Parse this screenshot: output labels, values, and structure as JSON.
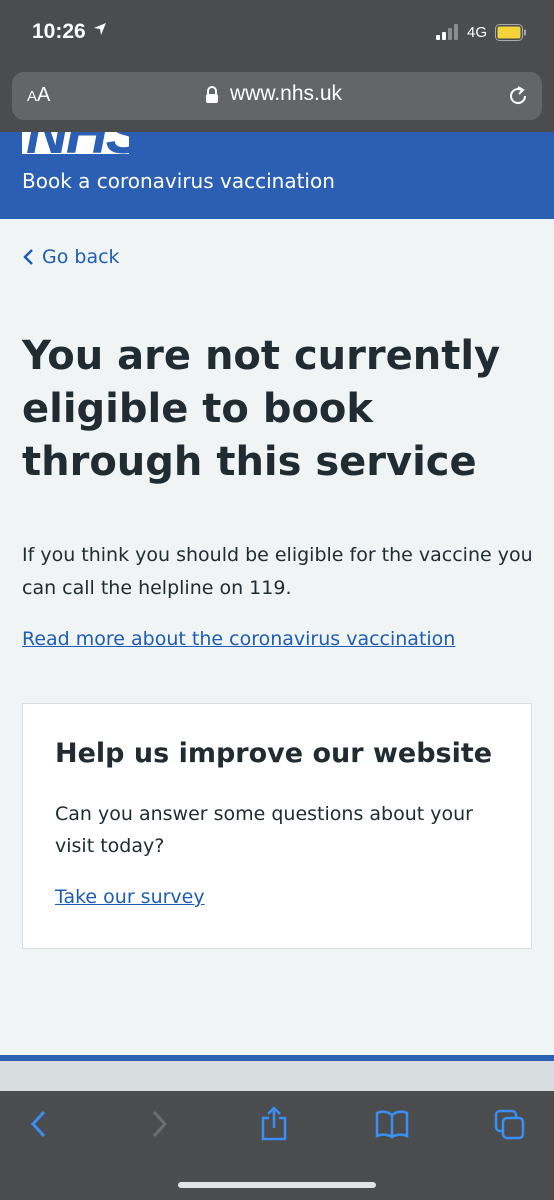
{
  "status_bar": {
    "time": "10:26",
    "network": "4G"
  },
  "browser": {
    "text_size_label": "AA",
    "url": "www.nhs.uk"
  },
  "header": {
    "logo_text": "NHS",
    "service_name": "Book a coronavirus vaccination"
  },
  "nav": {
    "back_label": "Go back"
  },
  "main": {
    "title": "You are not currently eligible to book through this service",
    "body": "If you think you should be eligible for the vaccine you can call the helpline on 119.",
    "link": "Read more about the coronavirus vaccination"
  },
  "feedback": {
    "heading": "Help us improve our website",
    "text": "Can you answer some questions about your visit today?",
    "link": "Take our survey"
  },
  "colors": {
    "nhs_blue": "#2a5fb4",
    "link": "#1e5db3",
    "text": "#212b32",
    "background": "#f0f4f5"
  },
  "toolbar": {
    "icons": [
      "back-icon",
      "forward-icon",
      "share-icon",
      "bookmarks-icon",
      "tabs-icon"
    ]
  }
}
